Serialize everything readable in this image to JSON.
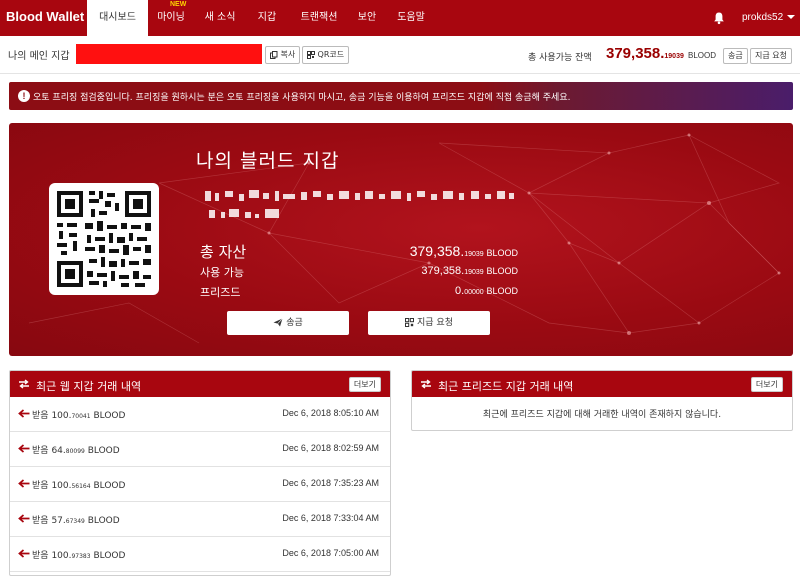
{
  "navbar": {
    "brand": "Blood Wallet",
    "tabs": [
      {
        "label": "대시보드",
        "active": true
      },
      {
        "label": "마이닝",
        "badge": "NEW"
      },
      {
        "label": "새 소식"
      },
      {
        "label": "지갑"
      },
      {
        "label": "트랜잭션"
      },
      {
        "label": "보안"
      },
      {
        "label": "도움말"
      }
    ],
    "username": "prokds52"
  },
  "wallet_bar": {
    "label": "나의 메인 지갑",
    "copy_label": "복사",
    "qr_label": "QR코드",
    "balance_label": "총 사용가능 잔액",
    "balance_int": "379,358.",
    "balance_dec": "19039",
    "balance_unit": "BLOOD",
    "send_label": "송금",
    "request_label": "지급 요청"
  },
  "alert": {
    "text": "오토 프리징 점검중입니다. 프리징을 원하시는 분은 오토 프리징을 사용하지 마시고, 송금 기능을 이용하여 프리즈드 지갑에 직접 송금해 주세요."
  },
  "hero": {
    "title": "나의 블러드 지갑",
    "total_label": "총 자산",
    "total_int": "379,358.",
    "total_dec": "19039",
    "available_label": "사용 가능",
    "available_int": "379,358.",
    "available_dec": "19039",
    "frozen_label": "프리즈드",
    "frozen_int": "0.",
    "frozen_dec": "00000",
    "unit": "BLOOD",
    "send_label": "송금",
    "request_label": "지급 요청"
  },
  "web_tx": {
    "title": "최근 웹 지갑 거래 내역",
    "more_label": "더보기",
    "rows": [
      {
        "type": "받음",
        "int": "100.",
        "dec": "70041",
        "unit": "BLOOD",
        "date": "Dec 6, 2018 8:05:10 AM"
      },
      {
        "type": "받음",
        "int": "64.",
        "dec": "80099",
        "unit": "BLOOD",
        "date": "Dec 6, 2018 8:02:59 AM"
      },
      {
        "type": "받음",
        "int": "100.",
        "dec": "56164",
        "unit": "BLOOD",
        "date": "Dec 6, 2018 7:35:23 AM"
      },
      {
        "type": "받음",
        "int": "57.",
        "dec": "67349",
        "unit": "BLOOD",
        "date": "Dec 6, 2018 7:33:04 AM"
      },
      {
        "type": "받음",
        "int": "100.",
        "dec": "97383",
        "unit": "BLOOD",
        "date": "Dec 6, 2018 7:05:00 AM"
      }
    ]
  },
  "frozen_tx": {
    "title": "최근 프리즈드 지갑 거래 내역",
    "more_label": "더보기",
    "empty_message": "최근에 프리즈드 지갑에 대해 거래한 내역이 존재하지 않습니다."
  },
  "colors": {
    "brand_red": "#a8060f",
    "balance_red": "#9a0000",
    "redaction": "#ff1010"
  },
  "icons": [
    "bell-icon",
    "copy-icon",
    "qrcode-icon",
    "info-icon",
    "paper-plane-icon",
    "exchange-icon",
    "arrow-left-icon"
  ]
}
